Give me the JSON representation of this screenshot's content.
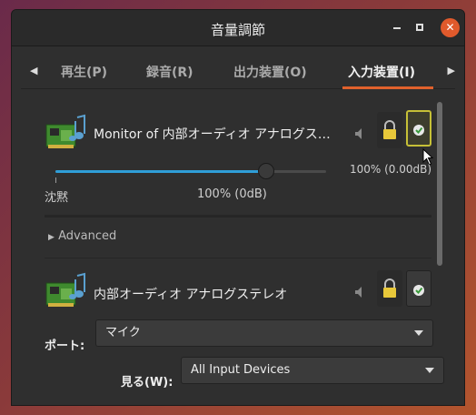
{
  "window": {
    "title": "音量調節"
  },
  "tabs": {
    "items": [
      {
        "label": "再生(P)"
      },
      {
        "label": "録音(R)"
      },
      {
        "label": "出力装置(O)"
      },
      {
        "label": "入力装置(I)"
      }
    ],
    "active_index": 3
  },
  "devices": [
    {
      "name": "Monitor of 内部オーディオ アナログス…",
      "volume_readout": "100% (0.00dB)",
      "volume_fraction": 0.78,
      "mark_silence": "沈黙",
      "mark_100": "100% (0dB)",
      "advanced_label": "Advanced",
      "default_selected": true
    },
    {
      "name": "内部オーディオ アナログステレオ",
      "port_label": "ポート:",
      "port_value": "マイク",
      "default_selected": false
    }
  ],
  "footer": {
    "show_label": "見る(W):",
    "show_value": "All Input Devices"
  },
  "colors": {
    "accent": "#e0612c",
    "slider": "#2f9ed8",
    "highlight": "#c6c037"
  }
}
